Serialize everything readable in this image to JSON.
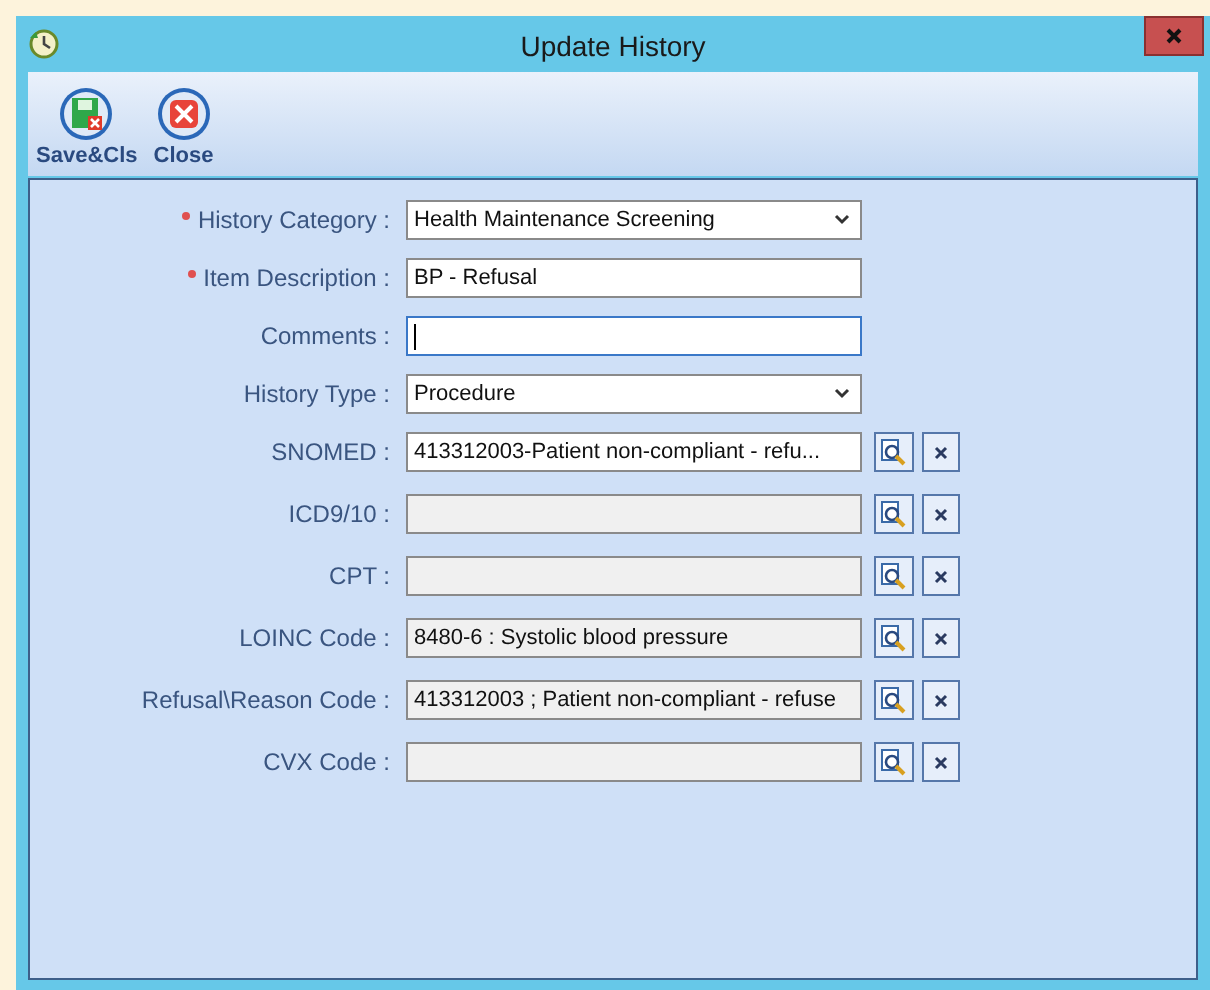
{
  "window": {
    "title": "Update History"
  },
  "toolbar": [
    {
      "kind": "save",
      "label": "Save&Cls"
    },
    {
      "kind": "close",
      "label": "Close"
    }
  ],
  "fields": [
    {
      "kind": "dropdown",
      "label": "History Category :",
      "required": true,
      "value": "Health Maintenance Screening",
      "disabled": false,
      "focused": false
    },
    {
      "kind": "text",
      "label": "Item Description :",
      "required": true,
      "value": "BP - Refusal",
      "disabled": false,
      "focused": false
    },
    {
      "kind": "text",
      "label": "Comments :",
      "required": false,
      "disabled": false,
      "focused": true
    },
    {
      "kind": "dropdown",
      "label": "History Type :",
      "required": false,
      "value": "Procedure",
      "disabled": false,
      "focused": false
    },
    {
      "kind": "lookup",
      "label": "SNOMED :",
      "required": false,
      "value": "413312003-Patient non-compliant - refu...",
      "disabled": false,
      "focused": false
    },
    {
      "kind": "lookup",
      "label": "ICD9/10 :",
      "required": false,
      "disabled": true,
      "focused": false
    },
    {
      "kind": "lookup",
      "label": "CPT :",
      "required": false,
      "disabled": true,
      "focused": false
    },
    {
      "kind": "lookup",
      "label": "LOINC Code :",
      "required": false,
      "value": "8480-6 : Systolic blood pressure",
      "disabled": true,
      "focused": false
    },
    {
      "kind": "lookup",
      "label": "Refusal\\Reason Code :",
      "required": false,
      "value": "413312003 ; Patient non-compliant - refuse",
      "disabled": true,
      "focused": false
    },
    {
      "kind": "lookup",
      "label": "CVX Code :",
      "required": false,
      "disabled": true,
      "focused": false
    }
  ]
}
